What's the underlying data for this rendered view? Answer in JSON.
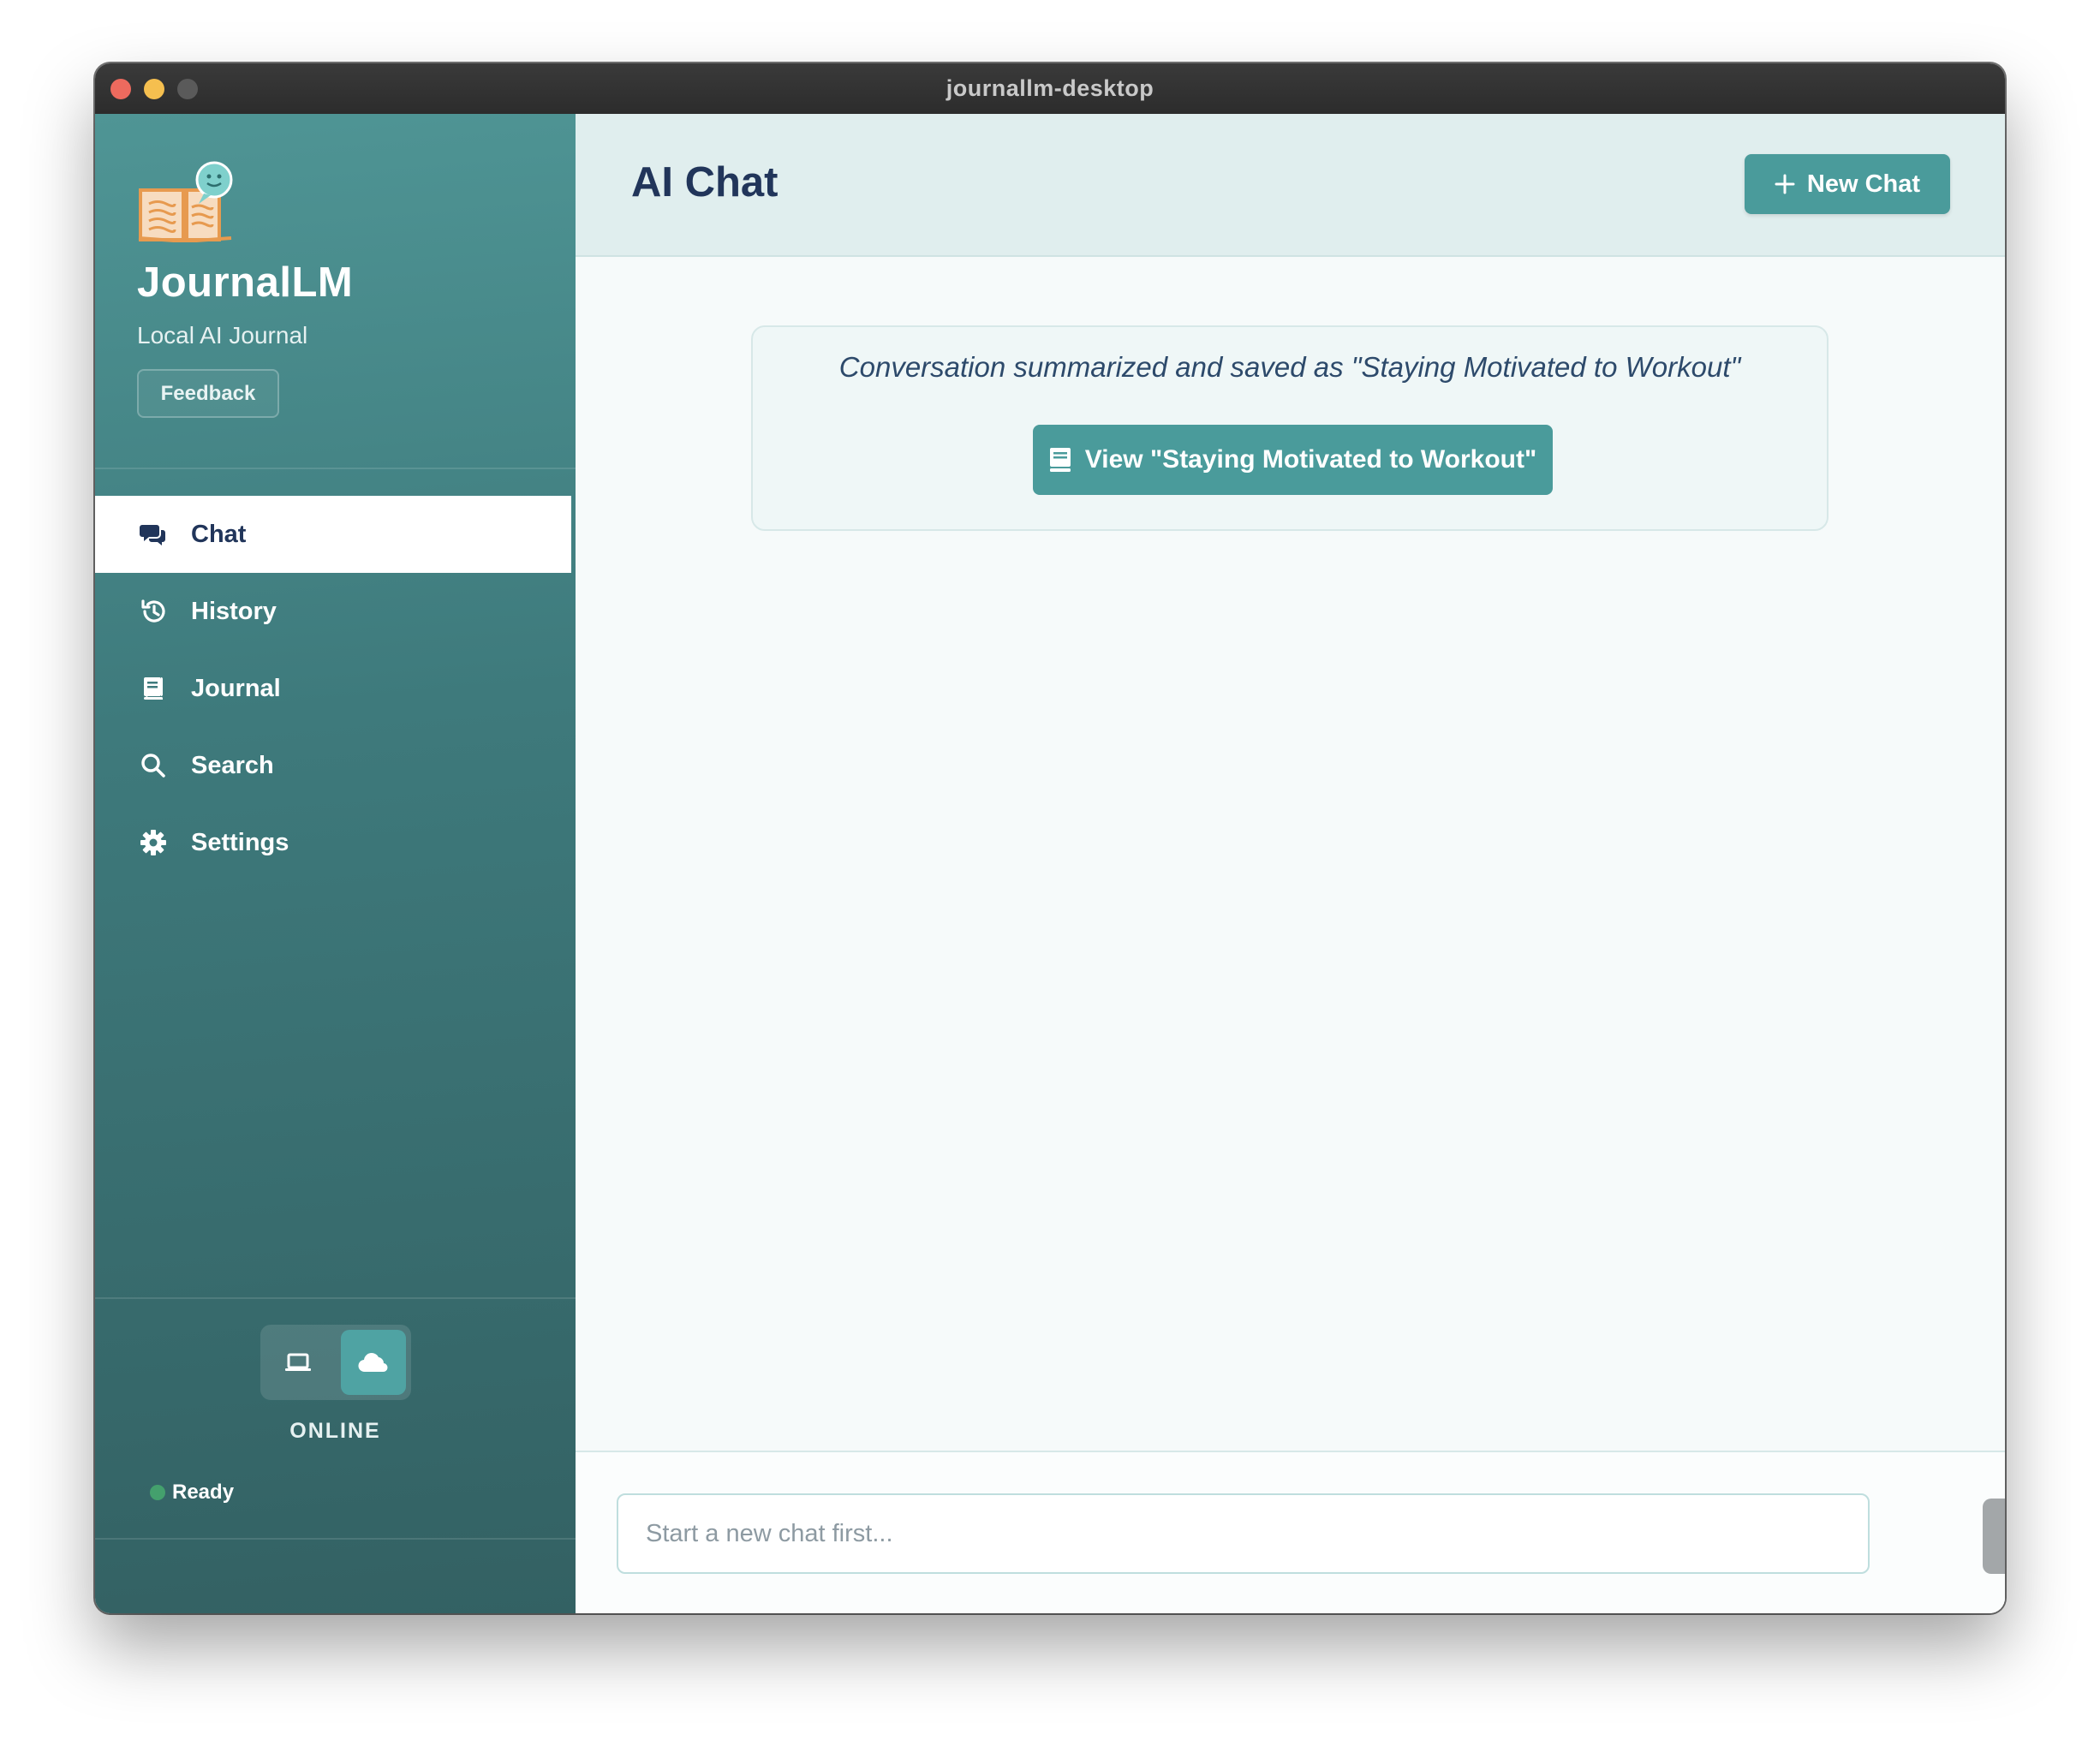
{
  "window": {
    "title": "journallm-desktop"
  },
  "sidebar": {
    "app_name": "JournalLM",
    "app_subtitle": "Local AI Journal",
    "feedback_label": "Feedback",
    "items": [
      {
        "label": "Chat",
        "icon": "comments-icon",
        "active": true
      },
      {
        "label": "History",
        "icon": "history-icon",
        "active": false
      },
      {
        "label": "Journal",
        "icon": "book-icon",
        "active": false
      },
      {
        "label": "Search",
        "icon": "search-icon",
        "active": false
      },
      {
        "label": "Settings",
        "icon": "gear-icon",
        "active": false
      }
    ],
    "mode": {
      "options": [
        "laptop-icon",
        "cloud-icon"
      ],
      "selected": "cloud-icon",
      "label": "ONLINE"
    },
    "status": {
      "label": "Ready",
      "color": "#44a06d"
    }
  },
  "main": {
    "title": "AI Chat",
    "new_chat_label": "New Chat",
    "notice": {
      "text": "Conversation summarized and saved as \"Staying Motivated to Workout\"",
      "button_label": "View \"Staying Motivated to Workout\""
    },
    "input": {
      "placeholder": "Start a new chat first...",
      "value": ""
    }
  },
  "colors": {
    "accent": "#4a9b9b",
    "sidebar_top": "#4f9595",
    "sidebar_bottom": "#336163",
    "heading": "#21355a",
    "send_disabled": "#a3a7a9"
  }
}
